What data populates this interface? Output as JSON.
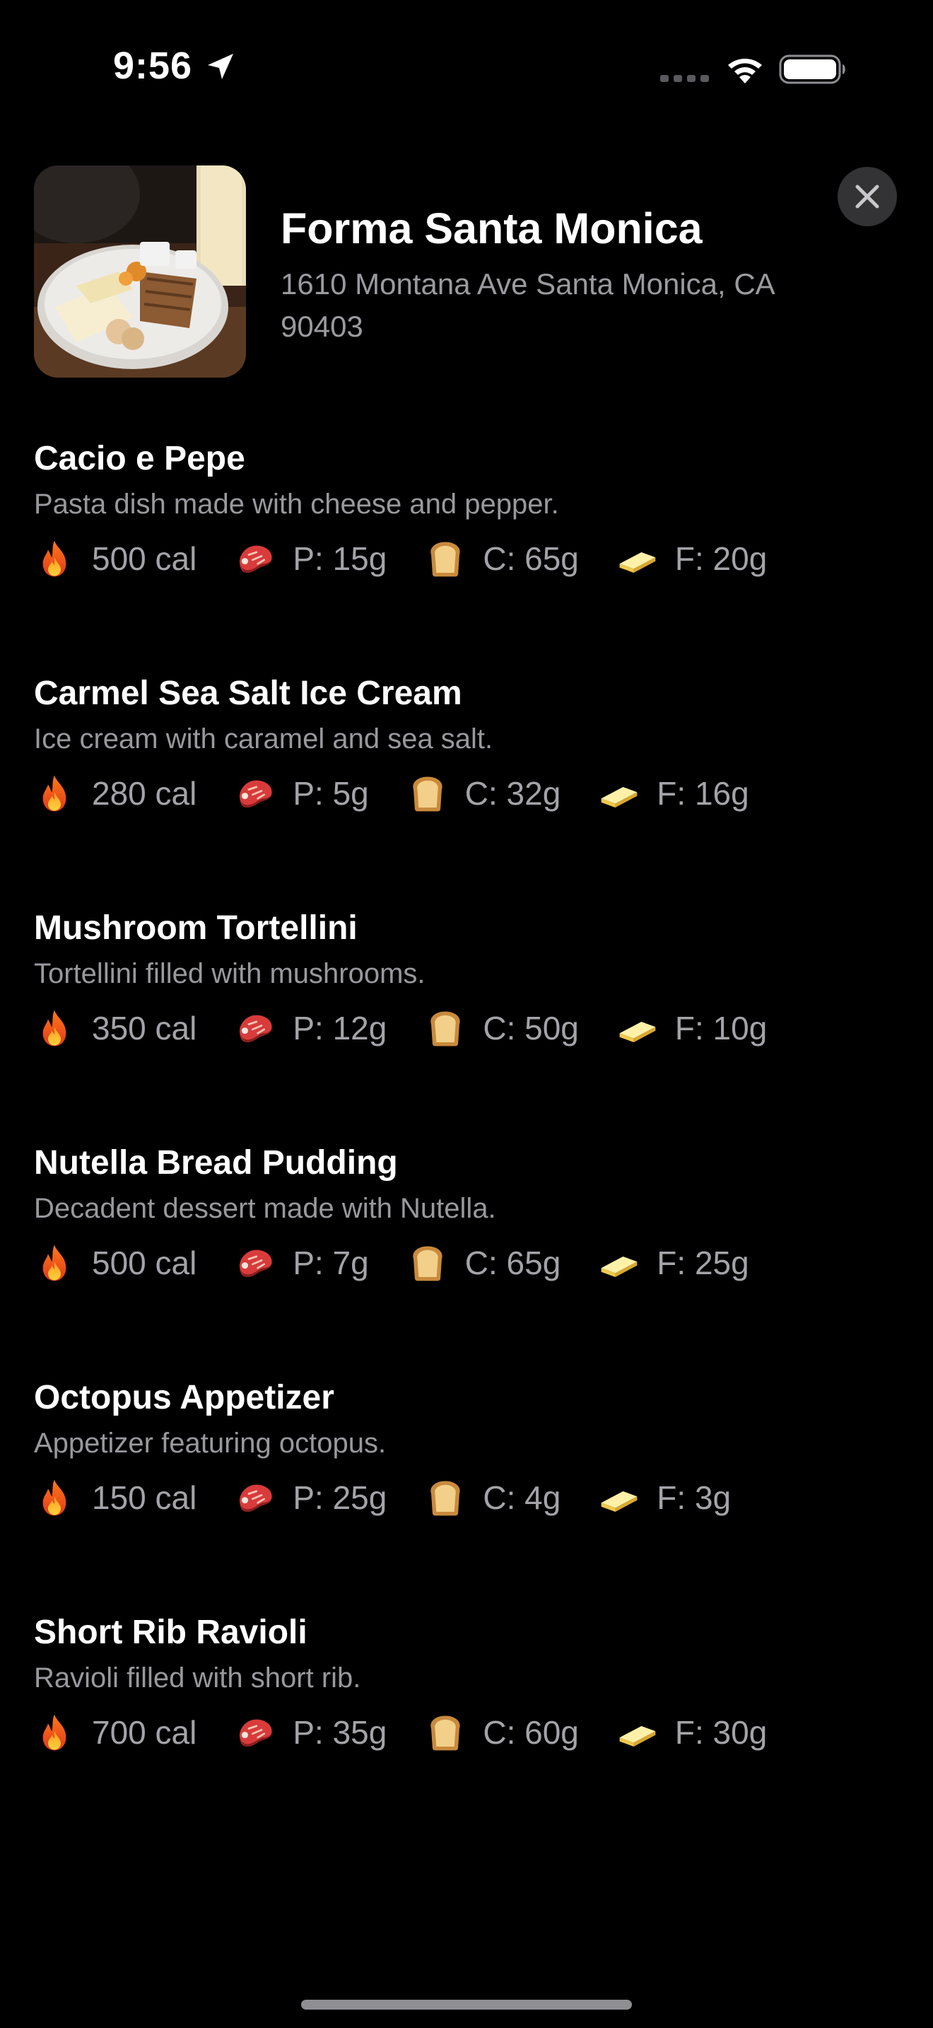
{
  "status_bar": {
    "time": "9:56"
  },
  "restaurant": {
    "name": "Forma Santa Monica",
    "address": "1610 Montana Ave Santa Monica, CA 90403"
  },
  "icons": {
    "calories": "fire-icon",
    "protein": "meat-icon",
    "carbs": "bread-icon",
    "fat": "butter-icon",
    "close": "close-icon",
    "location": "location-arrow-icon"
  },
  "colors": {
    "background": "#000000",
    "primary_text": "#ffffff",
    "secondary_text": "#98989d",
    "close_button_bg": "#333335"
  },
  "menu": {
    "items": [
      {
        "name": "Cacio e Pepe",
        "description": "Pasta dish made with cheese and pepper.",
        "calories": "500 cal",
        "protein": "P: 15g",
        "carbs": "C: 65g",
        "fat": "F: 20g"
      },
      {
        "name": "Carmel Sea Salt Ice Cream",
        "description": "Ice cream with caramel and sea salt.",
        "calories": "280 cal",
        "protein": "P: 5g",
        "carbs": "C: 32g",
        "fat": "F: 16g"
      },
      {
        "name": "Mushroom Tortellini",
        "description": "Tortellini filled with mushrooms.",
        "calories": "350 cal",
        "protein": "P: 12g",
        "carbs": "C: 50g",
        "fat": "F: 10g"
      },
      {
        "name": "Nutella Bread Pudding",
        "description": "Decadent dessert made with Nutella.",
        "calories": "500 cal",
        "protein": "P: 7g",
        "carbs": "C: 65g",
        "fat": "F: 25g"
      },
      {
        "name": "Octopus Appetizer",
        "description": "Appetizer featuring octopus.",
        "calories": "150 cal",
        "protein": "P: 25g",
        "carbs": "C: 4g",
        "fat": "F: 3g"
      },
      {
        "name": "Short Rib Ravioli",
        "description": "Ravioli filled with short rib.",
        "calories": "700 cal",
        "protein": "P: 35g",
        "carbs": "C: 60g",
        "fat": "F: 30g"
      }
    ]
  }
}
